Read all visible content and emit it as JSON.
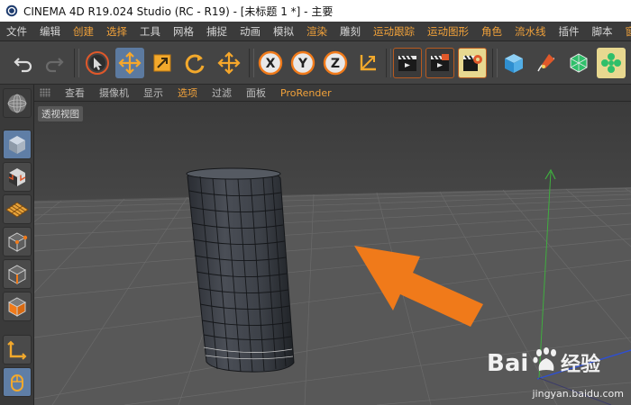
{
  "window": {
    "title": "CINEMA 4D R19.024 Studio (RC - R19) - [未标题 1 *] - 主要"
  },
  "menubar": {
    "items": [
      {
        "label": "文件",
        "orange": false
      },
      {
        "label": "编辑",
        "orange": false
      },
      {
        "label": "创建",
        "orange": true
      },
      {
        "label": "选择",
        "orange": true
      },
      {
        "label": "工具",
        "orange": false
      },
      {
        "label": "网格",
        "orange": false
      },
      {
        "label": "捕捉",
        "orange": false
      },
      {
        "label": "动画",
        "orange": false
      },
      {
        "label": "模拟",
        "orange": false
      },
      {
        "label": "渲染",
        "orange": true
      },
      {
        "label": "雕刻",
        "orange": false
      },
      {
        "label": "运动跟踪",
        "orange": true
      },
      {
        "label": "运动图形",
        "orange": true
      },
      {
        "label": "角色",
        "orange": true
      },
      {
        "label": "流水线",
        "orange": true
      },
      {
        "label": "插件",
        "orange": false
      },
      {
        "label": "脚本",
        "orange": false
      },
      {
        "label": "窗口",
        "orange": true
      }
    ]
  },
  "viewport_menu": {
    "items": [
      {
        "label": "查看",
        "orange": false
      },
      {
        "label": "摄像机",
        "orange": false
      },
      {
        "label": "显示",
        "orange": false
      },
      {
        "label": "选项",
        "orange": true
      },
      {
        "label": "过滤",
        "orange": false
      },
      {
        "label": "面板",
        "orange": false
      },
      {
        "label": "ProRender",
        "orange": true
      }
    ]
  },
  "viewport": {
    "label": "透视视图"
  },
  "axis_buttons": {
    "x": "X",
    "y": "Y",
    "z": "Z"
  },
  "watermark": {
    "brand": "Bai",
    "brand2": "经验",
    "url": "jingyan.baidu.com"
  },
  "colors": {
    "accent_orange": "#f07a1a",
    "active_blue": "#5c7aa0",
    "y_axis_green": "#3fae3f",
    "z_axis_blue": "#2d4fd6"
  }
}
